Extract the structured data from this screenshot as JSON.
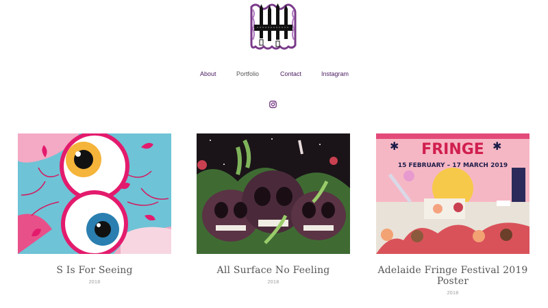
{
  "colors": {
    "accent": "#6a2a7a",
    "nav_link": "#4a1a60",
    "nav_active": "#555555",
    "title": "#555555",
    "year": "#9a9a9a"
  },
  "logo": {
    "icon": "pencil-brush-logo-icon"
  },
  "nav": {
    "items": [
      {
        "label": "About"
      },
      {
        "label": "Portfolio"
      },
      {
        "label": "Contact"
      },
      {
        "label": "Instagram"
      }
    ]
  },
  "social": {
    "icon": "instagram-icon"
  },
  "projects": [
    {
      "title": "S Is For Seeing",
      "year": "2018"
    },
    {
      "title": "All Surface No Feeling",
      "year": "2018"
    },
    {
      "title": "Adelaide Fringe Festival 2019 Poster",
      "year": "2018",
      "poster": {
        "heading": "FRINGE",
        "dates": "15 FEBRUARY – 17 MARCH 2019"
      }
    }
  ]
}
